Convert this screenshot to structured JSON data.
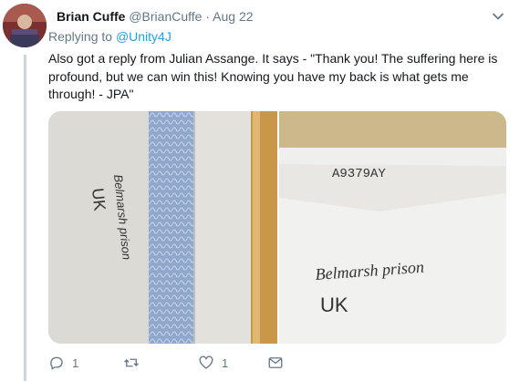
{
  "tweet": {
    "author_name": "Brian Cuffe",
    "handle": "@BrianCuffe",
    "separator": "·",
    "date": "Aug 22",
    "reply_prefix": "Replying to",
    "reply_to": "@Unity4J",
    "text": "Also got a reply from Julian Assange. It says - \"Thank you! The suffering here is profound, but we can win this! Knowing you have my back is what gets me through! - JPA\""
  },
  "media": {
    "photo_left": {
      "handwriting": [
        "Belmarsh prison",
        "UK"
      ]
    },
    "photo_right": {
      "handwriting": [
        "A9379AY",
        "Belmarsh prison",
        "UK"
      ]
    }
  },
  "actions": {
    "reply_count": "1",
    "retweet_count": "",
    "like_count": "1",
    "message_count": ""
  },
  "colors": {
    "accent": "#1da1f2",
    "secondary_text": "#657786",
    "primary_text": "#14171a"
  },
  "icons": [
    "reply-icon",
    "retweet-icon",
    "like-icon",
    "direct-message-icon",
    "chevron-down-icon"
  ]
}
